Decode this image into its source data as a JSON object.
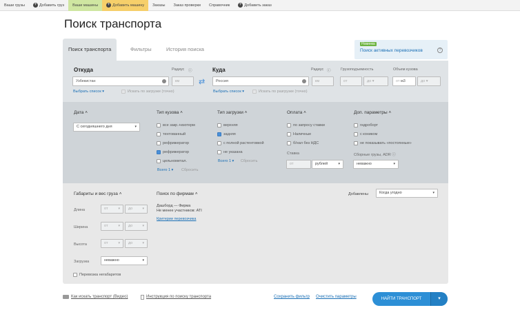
{
  "topbar": {
    "items": [
      "Ваши грузы",
      "Добавить груз",
      "Ваши машины",
      "Добавить машину",
      "Заказы",
      "Заказ проверки",
      "Справочник",
      "Добавить заказ"
    ]
  },
  "page": {
    "title": "Поиск транспорта"
  },
  "tabs": [
    "Поиск транспорта",
    "Фильтры",
    "История поиска"
  ],
  "promo": {
    "badge": "Новинка",
    "text": "Поиск активных перевозчиков"
  },
  "from": {
    "label": "Откуда",
    "radius_label": "Радиус",
    "value": "Узбекистан",
    "radius_placeholder": "км",
    "select_link": "Выбрать список",
    "checkbox_label": "Искать по загрузке (точно)"
  },
  "to": {
    "label": "Куда",
    "radius_label": "Радиус",
    "value": "Россия",
    "radius_placeholder": "км",
    "select_link": "Выбрать список",
    "checkbox_label": "Искать по разгрузке (точно)"
  },
  "capacity": {
    "label": "Грузоподъемность",
    "from": "от",
    "to": "до"
  },
  "volume": {
    "label": "Объем кузова",
    "from": "от",
    "unit": "м3",
    "to": "до"
  },
  "date": {
    "header": "Дата",
    "value": "С сегодняшнего дня"
  },
  "body_type": {
    "header": "Тип кузова",
    "options": [
      "все закр.+изотерм",
      "тентованный",
      "рефрижератор",
      "рефрижератор",
      "цельнометал."
    ],
    "checked": [
      false,
      false,
      false,
      true,
      false
    ],
    "all_link": "Всего 1",
    "reset": "Сбросить"
  },
  "loading_type": {
    "header": "Тип загрузки",
    "options": [
      "верхняя",
      "задняя",
      "с полной растентовкой",
      "не указана"
    ],
    "checked": [
      false,
      true,
      false,
      false
    ],
    "all_link": "Всего 1",
    "reset": "Сбросить"
  },
  "payment": {
    "header": "Оплата",
    "options": [
      "по запросу ставки",
      "Наличные",
      "б/нал без НДС"
    ],
    "rate_label": "Ставка",
    "rate_placeholder": "от",
    "currency": "рублей"
  },
  "extra": {
    "header": "Доп. параметры",
    "options": [
      "гидроборт",
      "с коником",
      "не показывать «постоянные»"
    ],
    "group_label": "Сборные грузы, ADR",
    "group_value": "неважно"
  },
  "dimensions": {
    "header": "Габариты и вес груза",
    "rows": [
      {
        "label": "Длина",
        "from": "от",
        "to": "до"
      },
      {
        "label": "Ширина",
        "from": "от",
        "to": "до"
      },
      {
        "label": "Высота",
        "from": "от",
        "to": "до"
      }
    ],
    "load_label": "Загрузка",
    "load_value": "неважно",
    "oversize_label": "Перевозка негабаритов"
  },
  "search_info": {
    "header": "Поиск по фирмам",
    "line1": "Дашборд — Фирма",
    "line2": "Не менее участников: ATI",
    "link": "Критерии перевозчика"
  },
  "added": {
    "label": "Добавлены",
    "value": "Когда угодно"
  },
  "footer": {
    "video_link": "Как искать транспорт (Видео)",
    "instr_link": "Инструкция по поиску транспорта",
    "save_link": "Сохранить фильтр",
    "clear_link": "Очистить параметры",
    "find_button": "НАЙТИ ТРАНСПОРТ"
  },
  "colors": {
    "accent": "#2d8fd6",
    "topbar_green": "#cfe6a1",
    "topbar_yellow": "#f6cf6a",
    "link": "#1a6fb5"
  }
}
